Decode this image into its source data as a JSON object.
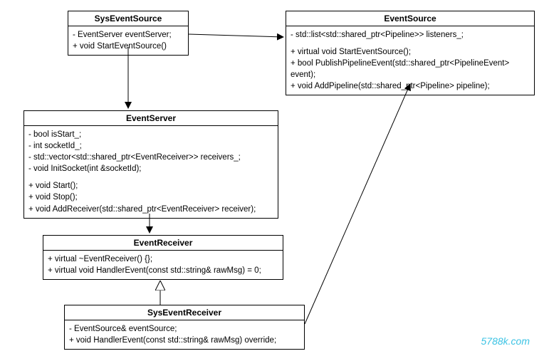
{
  "classes": {
    "sysEventSource": {
      "name": "SysEventSource",
      "attrs": {
        "a0": "- EventServer eventServer;",
        "a1": "+ void StartEventSource()"
      }
    },
    "eventSource": {
      "name": "EventSource",
      "attrs": {
        "a0": "- std::list<std::shared_ptr<Pipeline>> listeners_;",
        "a1": "+ virtual void StartEventSource();",
        "a2": "+ bool PublishPipelineEvent(std::shared_ptr<PipelineEvent> event);",
        "a3": "+ void AddPipeline(std::shared_ptr<Pipeline> pipeline);"
      }
    },
    "eventServer": {
      "name": "EventServer",
      "attrs": {
        "a0": "- bool isStart_;",
        "a1": "- int socketId_;",
        "a2": "- std::vector<std::shared_ptr<EventReceiver>> receivers_;",
        "a3": "- void InitSocket(int &socketId);",
        "a4": "+ void Start();",
        "a5": "+ void Stop();",
        "a6": "+ void AddReceiver(std::shared_ptr<EventReceiver> receiver);"
      }
    },
    "eventReceiver": {
      "name": "EventReceiver",
      "attrs": {
        "a0": "+ virtual ~EventReceiver() {};",
        "a1": "+ virtual void HandlerEvent(const std::string& rawMsg) = 0;"
      }
    },
    "sysEventReceiver": {
      "name": "SysEventReceiver",
      "attrs": {
        "a0": "- EventSource& eventSource;",
        "a1": "+ void HandlerEvent(const std::string& rawMsg) override;"
      }
    }
  },
  "watermark": "5788k.com"
}
